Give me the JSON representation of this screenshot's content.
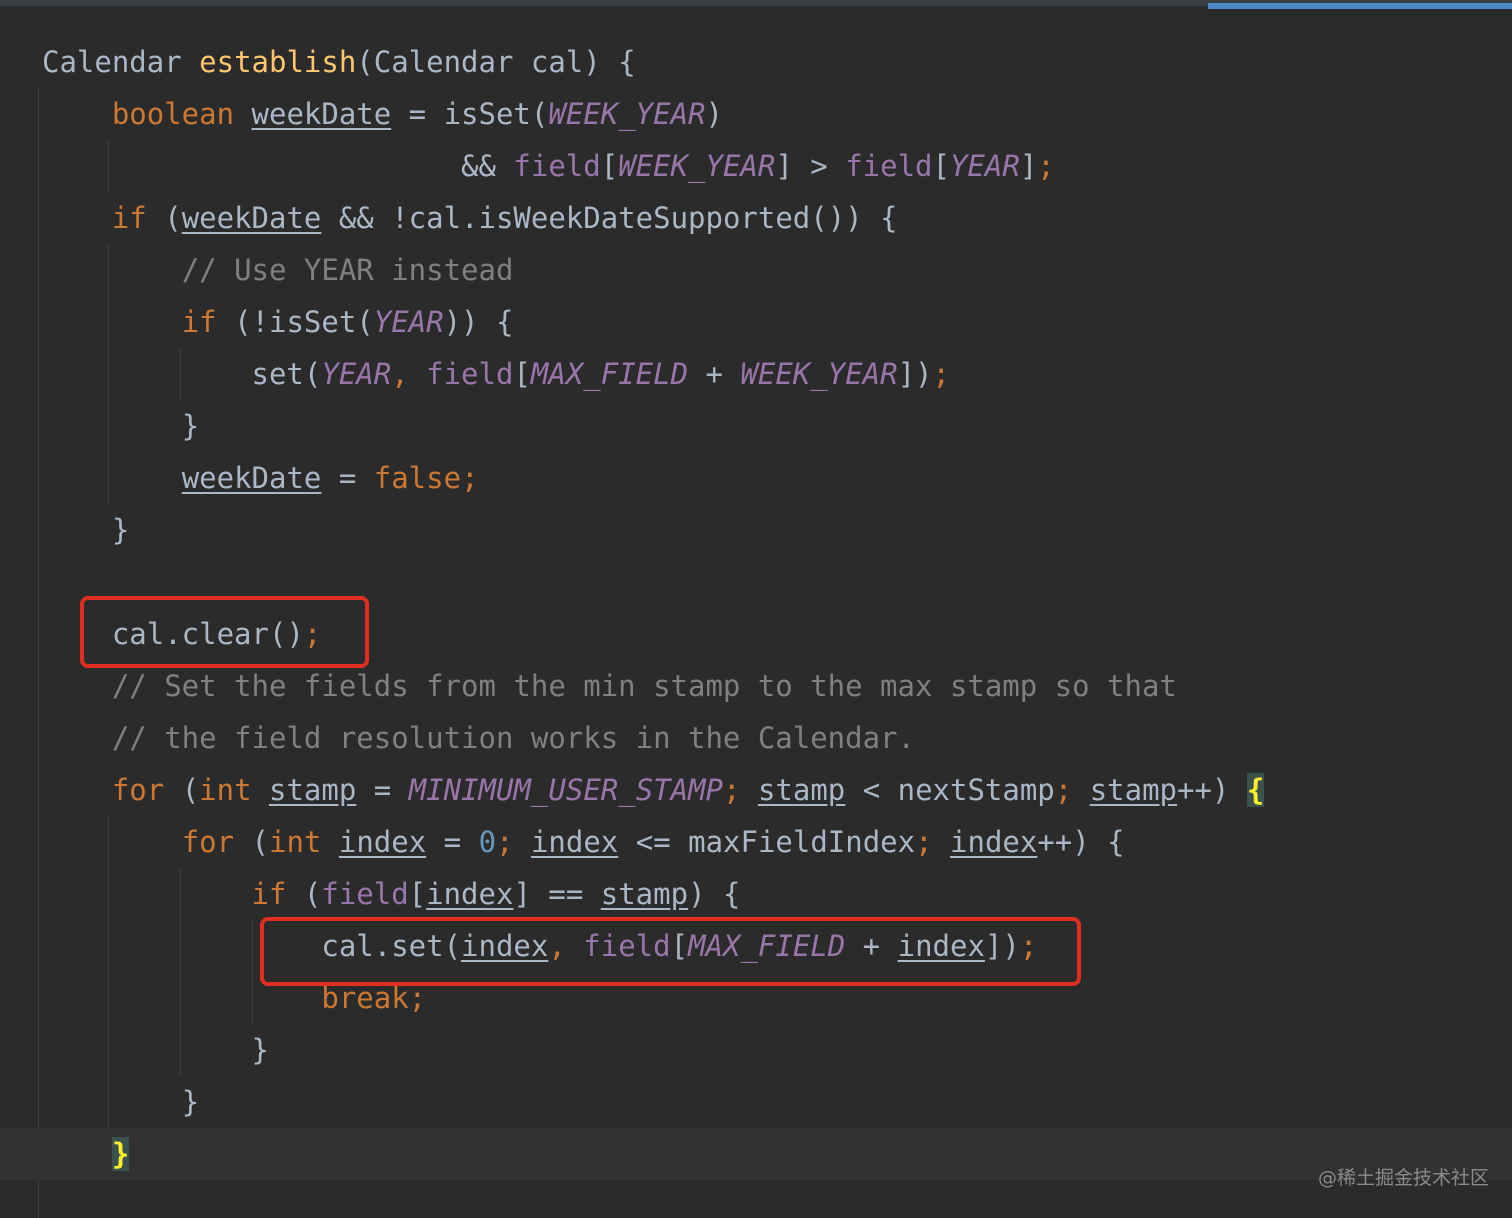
{
  "code": {
    "l1_type": "Calendar",
    "l1_method": "establish",
    "l1_params": "(Calendar cal) {",
    "l2_type": "boolean",
    "l2_var": "weekDate",
    "l2_eq": " = isSet(",
    "week_year": "WEEK_YEAR",
    "year": "YEAR",
    "close_paren": ")",
    "l3_and": "&& ",
    "field": "field",
    "open_bracket": "[",
    "l3_gt": "] > ",
    "l3_end": "]",
    "semicolon": ";",
    "kw_if": "if",
    "l4_open": " (",
    "l4_mid": " && !cal.isWeekDateSupported()) {",
    "l5_comment": "// Use YEAR instead",
    "l6_mid": " (!isSet(",
    "l6_end": ")) {",
    "l7_set": "set(",
    "comma": ",",
    "plus": " + ",
    "max_field": "MAX_FIELD",
    "l7_end": "])",
    "close_brace": "}",
    "assign": " = ",
    "kw_false": "false",
    "l11_clear": "cal.clear()",
    "l12_comment": "// Set the fields from the min stamp to the max stamp so that",
    "l13_comment": "// the field resolution works in the Calendar.",
    "kw_for": "for",
    "kw_int": "int",
    "var_stamp": "stamp",
    "min_user_stamp": "MINIMUM_USER_STAMP",
    "l14_lt": " < nextStamp",
    "incr_close": "++) ",
    "open_brace": "{",
    "var_index": "index",
    "num_zero": "0",
    "l15_le": " <= maxFieldIndex",
    "l15_end": "++) {",
    "l16_eq": "] == ",
    "l16_end": ") {",
    "l17_set": "cal.set(",
    "l17_end": "])",
    "kw_break": "break"
  },
  "watermark": "@稀土掘金技术社区",
  "colors": {
    "background": "#2b2b2b",
    "keyword": "#cc7832",
    "method": "#ffc66d",
    "constant": "#9876aa",
    "comment": "#808080",
    "number": "#6897bb",
    "text": "#a9b7c6",
    "highlight_box": "#e02f20"
  }
}
